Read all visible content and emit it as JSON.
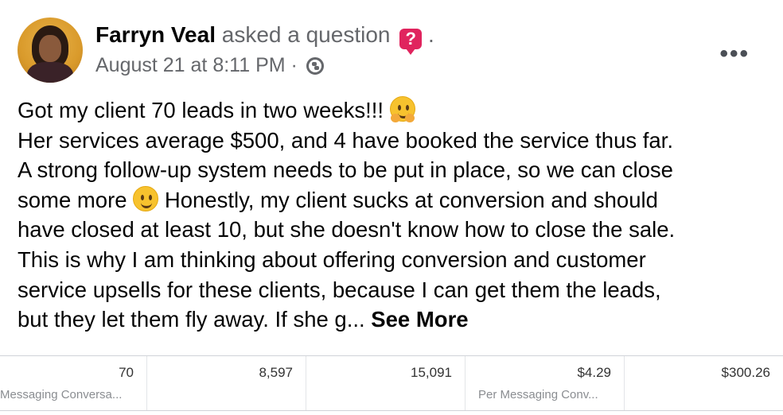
{
  "post": {
    "author": "Farryn Veal",
    "action": "asked a question",
    "question_icon": "?",
    "trailing_dot": ".",
    "date": "August 21 at 8:11 PM",
    "separator": "·",
    "audience_icon": "globe-icon",
    "more_label": "•••",
    "lines": [
      "Got my client 70 leads in two weeks!!! ",
      "Her services average $500, and 4 have booked the service thus far.",
      "A strong follow-up system needs to be put in place, so we can close",
      "some more ",
      " Honestly, my client sucks at conversion and should",
      "have closed at least 10, but she doesn't know how to close the sale.",
      "This is why I am thinking about offering conversion and customer",
      "service upsells for these clients, because I can get them the leads,",
      "but they let them fly away.  If she g... "
    ],
    "see_more": "See More"
  },
  "stats": [
    {
      "value": "70",
      "label": "Messaging Conversa..."
    },
    {
      "value": "8,597",
      "label": ""
    },
    {
      "value": "15,091",
      "label": ""
    },
    {
      "value": "$4.29",
      "label": "Per Messaging Conv..."
    },
    {
      "value": "$300.26",
      "label": ""
    }
  ],
  "colors": {
    "question_badge": "#e0245e",
    "secondary_text": "#65676b",
    "primary_text": "#050505"
  }
}
